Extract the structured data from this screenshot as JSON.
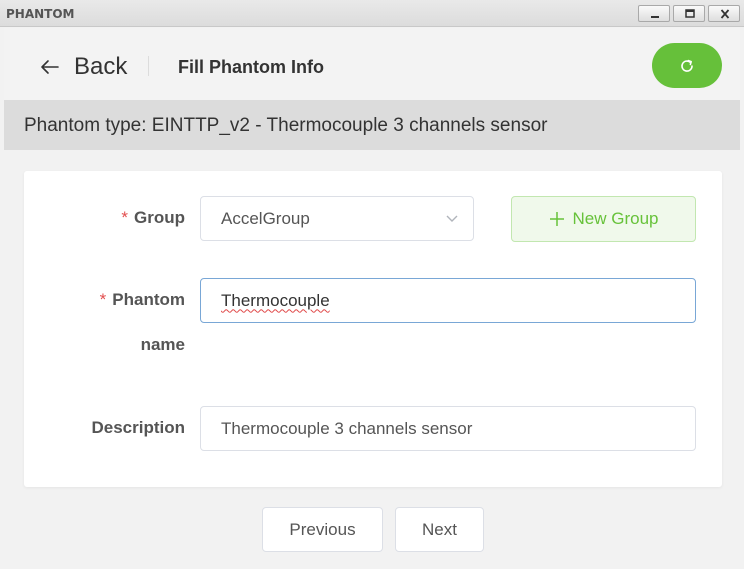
{
  "window": {
    "title": "PHANTOM",
    "controls": [
      "minimize-icon",
      "maximize-icon",
      "close-icon"
    ]
  },
  "header": {
    "back_label": "Back",
    "title": "Fill Phantom Info",
    "refresh_icon": "refresh-icon"
  },
  "banner": {
    "text": "Phantom type: EINTTP_v2 - Thermocouple 3 channels sensor"
  },
  "form": {
    "group": {
      "required_mark": "*",
      "label": "Group",
      "value": "AccelGroup",
      "new_group_label": "New Group"
    },
    "phantom_name": {
      "required_mark": "*",
      "label_line1": "Phantom",
      "label_line2": "name",
      "value": "Thermocouple"
    },
    "description": {
      "label": "Description",
      "value": "Thermocouple 3 channels sensor"
    }
  },
  "footer": {
    "previous_label": "Previous",
    "next_label": "Next"
  },
  "colors": {
    "accent_green": "#66c03a",
    "required_red": "#e24d4d",
    "focus_blue": "#79a7d6"
  }
}
